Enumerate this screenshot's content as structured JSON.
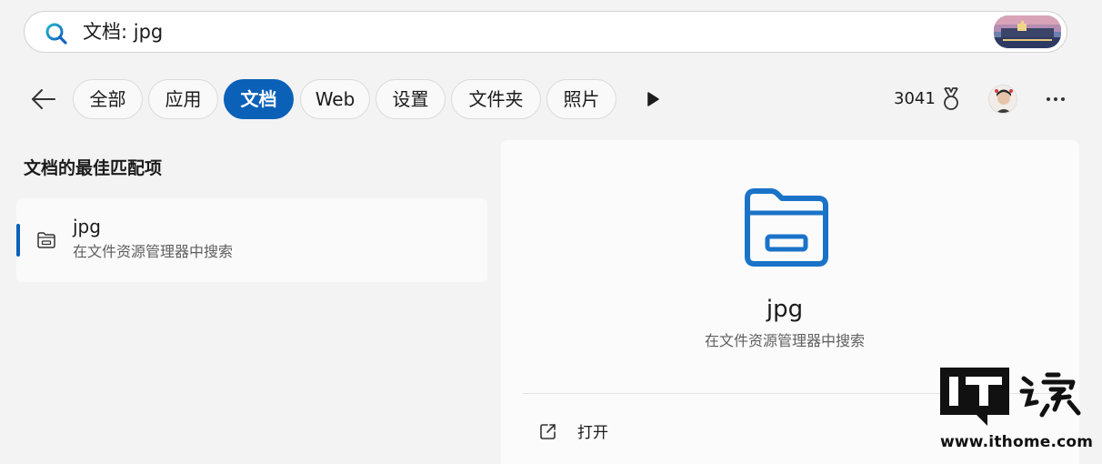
{
  "search": {
    "query": "文档: jpg"
  },
  "tabs": [
    {
      "label": "全部",
      "active": false
    },
    {
      "label": "应用",
      "active": false
    },
    {
      "label": "文档",
      "active": true
    },
    {
      "label": "Web",
      "active": false
    },
    {
      "label": "设置",
      "active": false
    },
    {
      "label": "文件夹",
      "active": false
    },
    {
      "label": "照片",
      "active": false
    }
  ],
  "header": {
    "points": "3041"
  },
  "results": {
    "section_title": "文档的最佳匹配项",
    "best_match": {
      "title": "jpg",
      "subtitle": "在文件资源管理器中搜索"
    }
  },
  "detail": {
    "title": "jpg",
    "subtitle": "在文件资源管理器中搜索",
    "actions": [
      {
        "label": "打开",
        "icon": "open-external-icon"
      }
    ]
  },
  "watermark": {
    "brand": "IT之家",
    "url": "www.ithome.com"
  },
  "colors": {
    "accent": "#0b61b8",
    "folder_icon": "#1a73c8"
  }
}
